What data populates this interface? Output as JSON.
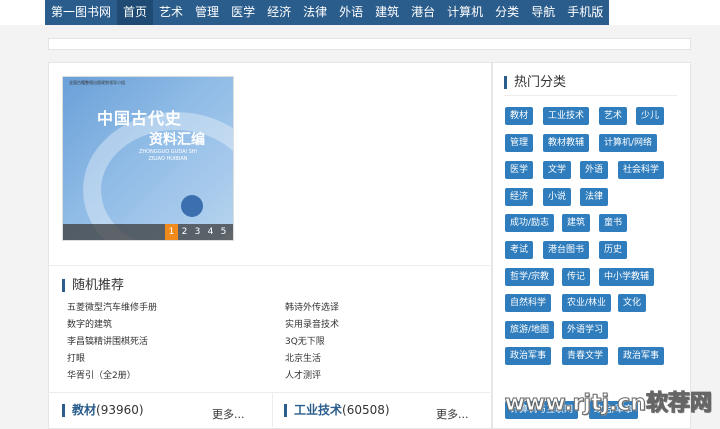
{
  "nav": [
    "第一图书网",
    "首页",
    "艺术",
    "管理",
    "医学",
    "经济",
    "法律",
    "外语",
    "建筑",
    "港台",
    "计算机",
    "分类",
    "导航",
    "手机版"
  ],
  "cover": {
    "header": "全国古籍整理出版规划领导小组",
    "title_line1": "中国古代史",
    "title_line2": "资料汇编",
    "pinyin_line1": "ZHONGGUO GUDAI SHI",
    "pinyin_line2": "ZILIAO HUIBIAN",
    "pages": [
      "1",
      "2",
      "3",
      "4",
      "5"
    ]
  },
  "random": {
    "title": "随机推荐",
    "items": [
      "五菱微型汽车维修手册",
      "韩诗外传选译",
      "数字的建筑",
      "实用录音技术",
      "李昌镐精讲围棋死活",
      "3Q无下限",
      "打眼",
      "北京生活",
      "华胥引（全2册）",
      "人才测评"
    ]
  },
  "categories": [
    {
      "name": "教材",
      "count": "(93960)",
      "more": "更多..."
    },
    {
      "name": "工业技术",
      "count": "(60508)",
      "more": "更多..."
    }
  ],
  "sidebar": {
    "title": "热门分类",
    "tags": [
      "教材",
      "工业技术",
      "艺术",
      "少儿",
      "管理",
      "教材教辅",
      "计算机/网络",
      "医学",
      "文学",
      "外语",
      "社会科学",
      "经济",
      "小说",
      "法律",
      "成功/励志",
      "建筑",
      "童书",
      "考试",
      "港台图书",
      "历史",
      "哲学/宗教",
      "传记",
      "中小学教辅",
      "自然科学",
      "农业/林业",
      "文化",
      "旅游/地图",
      "外语学习",
      "政治军事",
      "青春文学",
      "政治军事",
      "计算机与互联网",
      "政治/军事"
    ]
  },
  "watermark": "www.rjtj.cn软荐网"
}
